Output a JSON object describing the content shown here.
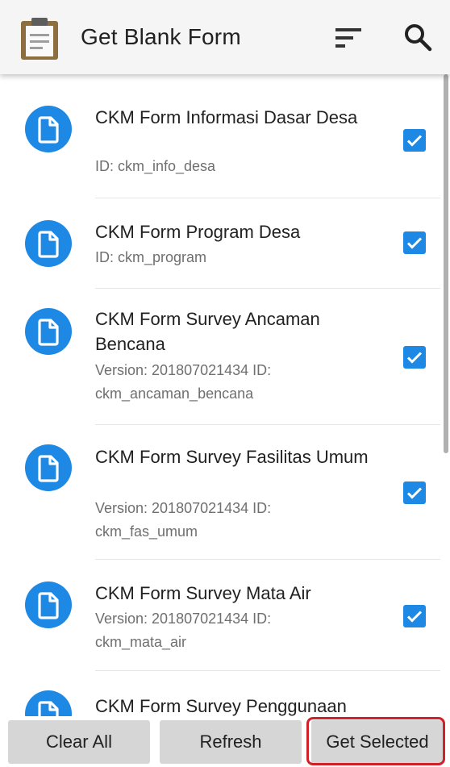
{
  "app_bar": {
    "title": "Get Blank Form",
    "icons": [
      "clipboard-icon",
      "sort-icon",
      "search-icon"
    ]
  },
  "forms": [
    {
      "title": "CKM Form Informasi Dasar Desa",
      "subtitle": "ID: ckm_info_desa",
      "checked": true
    },
    {
      "title": "CKM Form Program Desa",
      "subtitle": "ID: ckm_program",
      "checked": true
    },
    {
      "title": "CKM Form Survey Ancaman Bencana",
      "subtitle": "Version: 201807021434 ID: ckm_ancaman_bencana",
      "checked": true
    },
    {
      "title": "CKM Form Survey Fasilitas Umum",
      "subtitle": "Version: 201807021434 ID: ckm_fas_umum",
      "checked": true
    },
    {
      "title": "CKM Form Survey Mata Air",
      "subtitle": "Version: 201807021434 ID: ckm_mata_air",
      "checked": true
    },
    {
      "title": "CKM Form Survey Penggunaan",
      "subtitle": "",
      "checked": true
    }
  ],
  "buttons": {
    "clear_all": "Clear All",
    "refresh": "Refresh",
    "get_selected": "Get Selected"
  },
  "colors": {
    "accent": "#1e88e5",
    "highlight": "#d0202a",
    "button_bg": "#d6d6d6",
    "app_bar_bg": "#f5f5f5"
  }
}
